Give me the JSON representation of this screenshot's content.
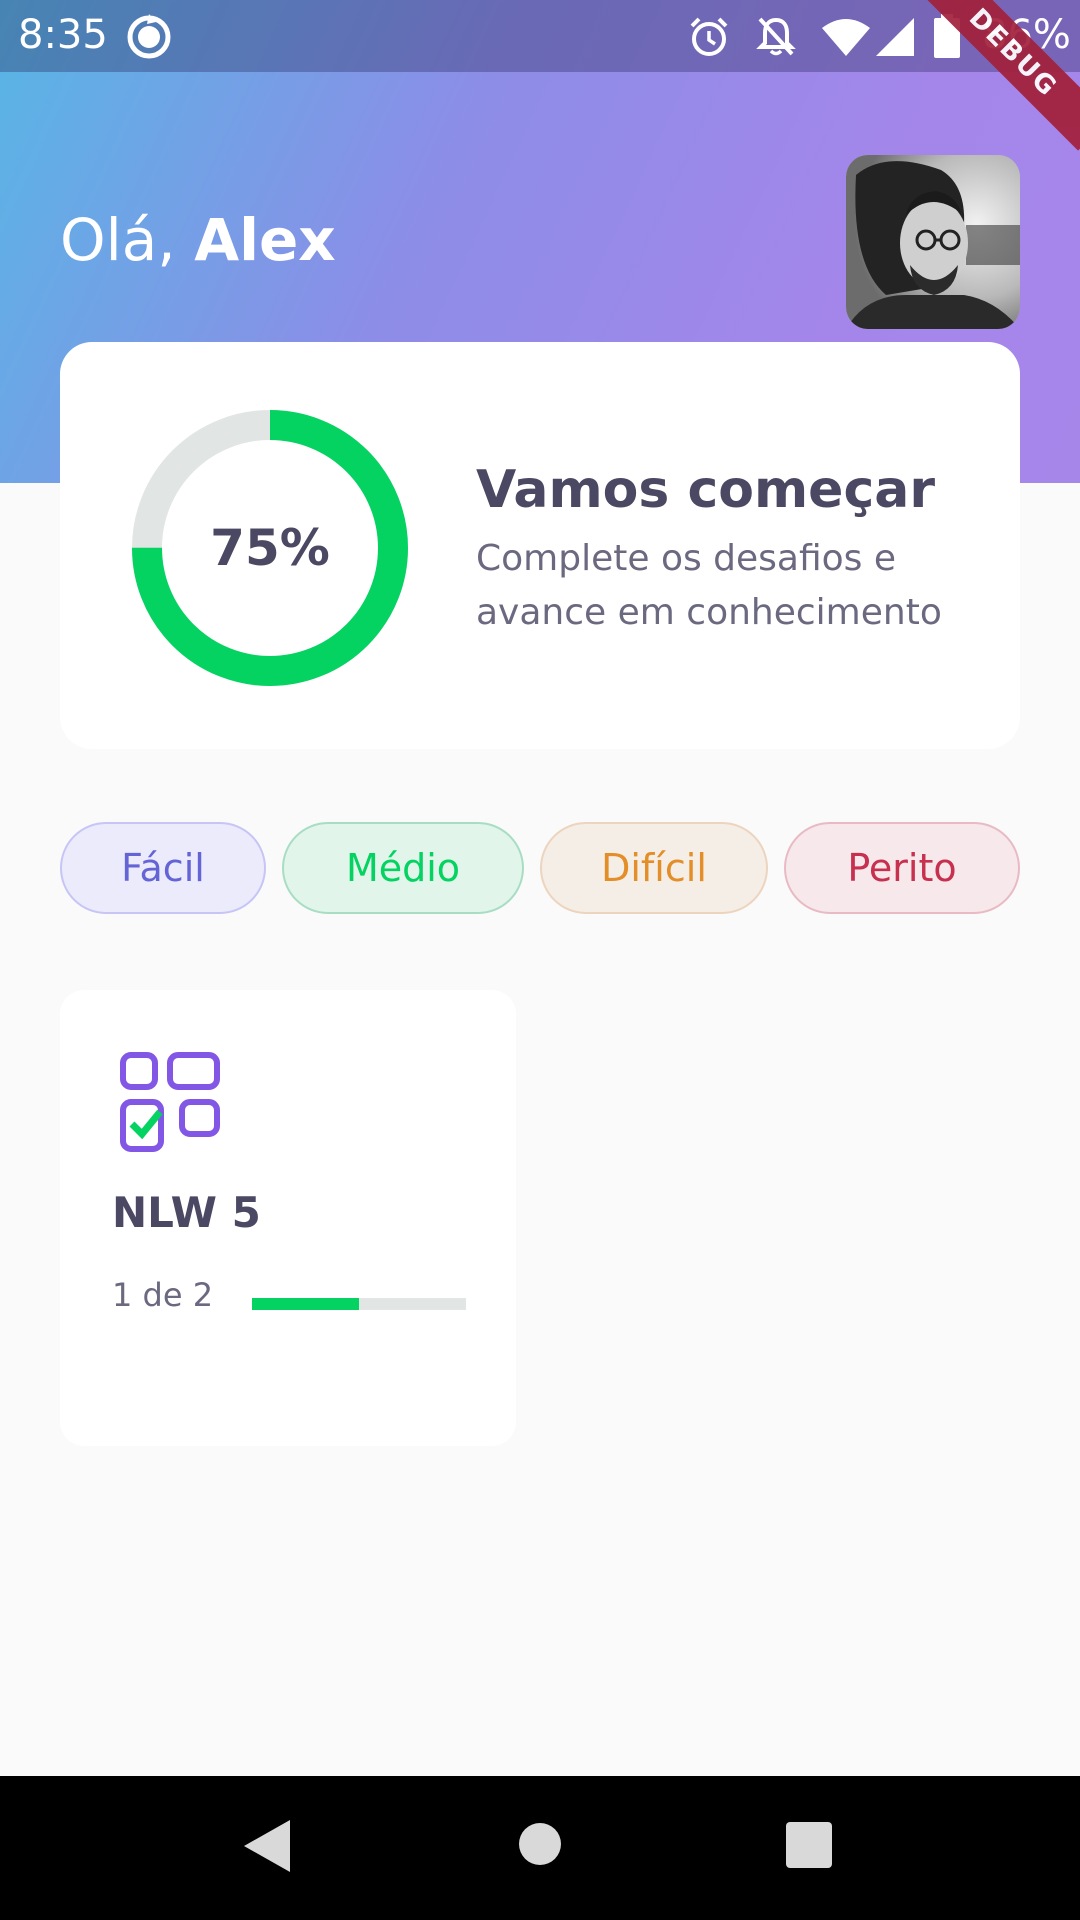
{
  "status_bar": {
    "time": "8:35",
    "battery": "86%",
    "icons": [
      "sync-circle-icon",
      "alarm-icon",
      "bell-off-icon",
      "wifi-icon",
      "signal-icon",
      "battery-icon"
    ]
  },
  "debug_banner": "DEBUG",
  "header": {
    "greeting_prefix": "Olá, ",
    "user_name": "Alex"
  },
  "score_card": {
    "percent_label": "75%",
    "progress": 0.75,
    "title": "Vamos começar",
    "subtitle": "Complete os desafios e avance em conhecimento"
  },
  "levels": [
    {
      "label": "Fácil",
      "color": "#6464D6",
      "bg": "#EBEBFC",
      "border": "#C6C5F5"
    },
    {
      "label": "Médio",
      "color": "#04D361",
      "bg": "#E1F5EB",
      "border": "#A8DDC4"
    },
    {
      "label": "Difícil",
      "color": "#E38E28",
      "bg": "#F5EEE6",
      "border": "#ECD4BE"
    },
    {
      "label": "Perito",
      "color": "#C7304E",
      "bg": "#F6E8EB",
      "border": "#E8BAC4"
    }
  ],
  "quizzes": [
    {
      "icon": "check-grid-icon",
      "title": "NLW 5",
      "progress_text": "1 de 2",
      "progress": 0.5
    }
  ],
  "colors": {
    "accent_green": "#04D361",
    "heading": "#4B4863",
    "gradient_start": "#57B6E5",
    "gradient_end": "#A786EA"
  },
  "navigation": [
    "back-icon",
    "home-icon",
    "recents-icon"
  ]
}
